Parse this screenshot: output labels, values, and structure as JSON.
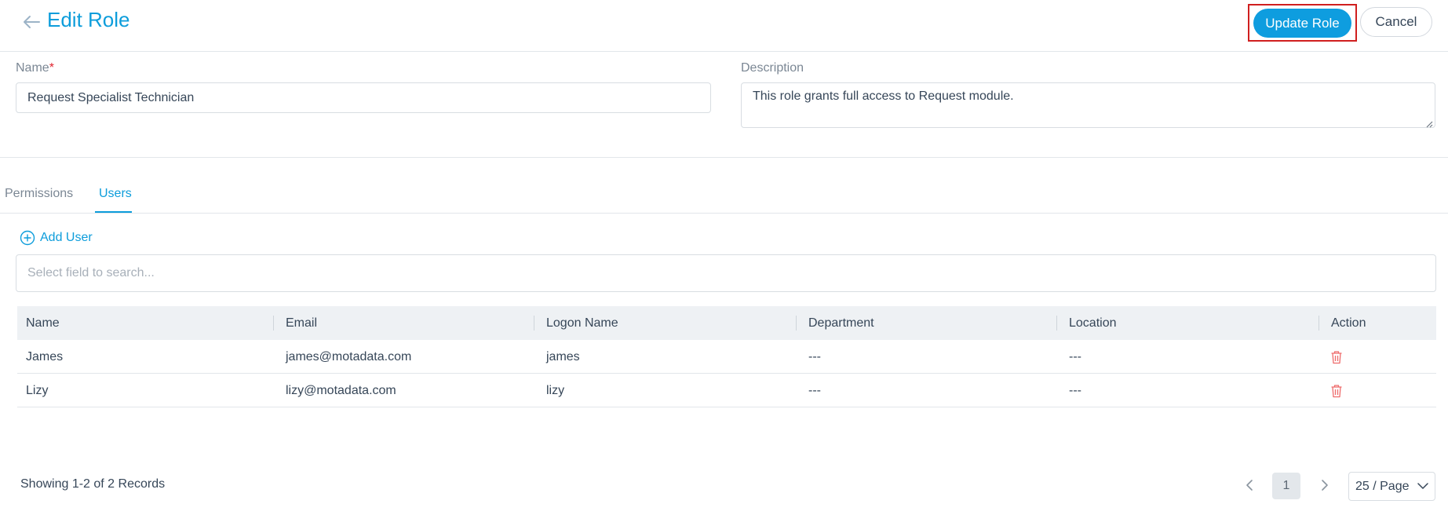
{
  "header": {
    "title": "Edit Role",
    "update_label": "Update Role",
    "cancel_label": "Cancel"
  },
  "form": {
    "name_label": "Name",
    "name_required_mark": "*",
    "name_value": "Request Specialist Technician",
    "description_label": "Description",
    "description_value": "This role grants full access to Request module."
  },
  "tabs": [
    {
      "label": "Permissions",
      "active": false
    },
    {
      "label": "Users",
      "active": true
    }
  ],
  "users": {
    "add_label": "Add User",
    "search_placeholder": "Select field to search...",
    "columns": [
      "Name",
      "Email",
      "Logon Name",
      "Department",
      "Location",
      "Action"
    ],
    "rows": [
      {
        "name": "James",
        "email": "james@motadata.com",
        "logon": "james",
        "department": "---",
        "location": "---"
      },
      {
        "name": "Lizy",
        "email": "lizy@motadata.com",
        "logon": "lizy",
        "department": "---",
        "location": "---"
      }
    ]
  },
  "footer": {
    "records_text": "Showing 1-2 of 2 Records",
    "current_page": "1",
    "page_size": "25 / Page"
  },
  "colors": {
    "accent": "#0d9ddb",
    "danger": "#e0242f",
    "highlight_border": "#d01f1f"
  },
  "icons": [
    "back-arrow-icon",
    "add-circle-icon",
    "trash-icon",
    "chevron-left-icon",
    "chevron-right-icon",
    "chevron-down-icon",
    "resize-grip-icon"
  ]
}
